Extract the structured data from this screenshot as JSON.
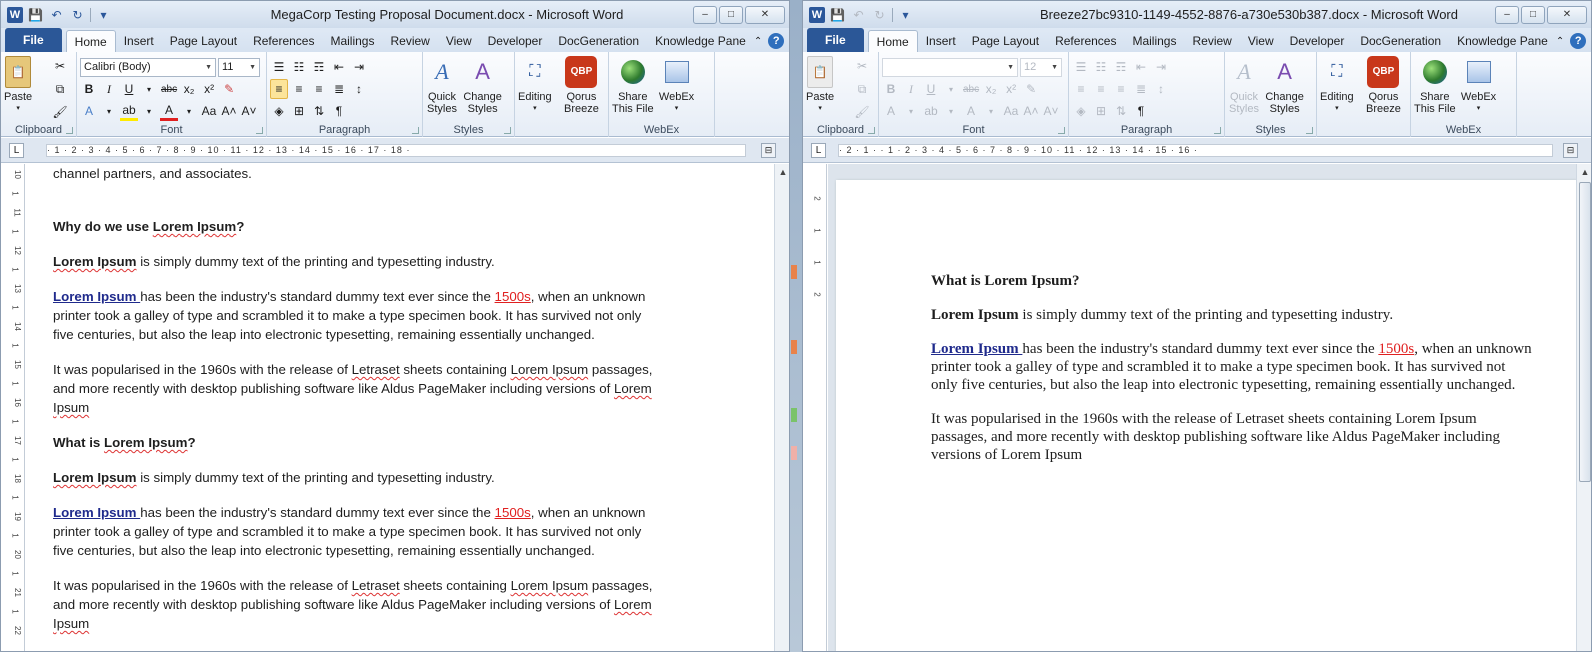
{
  "left": {
    "title": "MegaCorp Testing Proposal Document.docx  -  Microsoft Word",
    "tabs": [
      "File",
      "Home",
      "Insert",
      "Page Layout",
      "References",
      "Mailings",
      "Review",
      "View",
      "Developer",
      "DocGeneration",
      "Knowledge Pane"
    ],
    "font_name": "Calibri (Body)",
    "font_size": "11",
    "ruler": "· 1 · 2 · 3 · 4 · 5 · 6 · 7 · 8 · 9 · 10 · 11 · 12 · 13 · 14 · 15 · 16 · 17 · 18 ·",
    "vruler": [
      "10",
      "1",
      "11",
      "1",
      "12",
      "1",
      "13",
      "1",
      "14",
      "1",
      "15",
      "1",
      "16",
      "1",
      "17",
      "1",
      "18",
      "1",
      "19",
      "1",
      "20",
      "1",
      "21",
      "1",
      "22"
    ],
    "doc": {
      "p0": "channel partners, and associates.",
      "h1_a": "Why do we use ",
      "h1_b": "Lorem Ipsum",
      "h1_c": "?",
      "s1_a": "Lorem Ipsum",
      "s1_b": " is simply dummy text of the printing and typesetting industry.",
      "l1_a": "Lorem Ipsum ",
      "l1_b": "has been the industry's standard dummy text ever since the ",
      "l1_c": "1500s",
      "l1_d": ", when an unknown printer took a galley of type and scrambled it to make a type specimen book. It has survived not only five centuries, but also the leap into electronic typesetting, remaining essentially unchanged.",
      "p1_a": "It was popularised in the 1960s  with the release of ",
      "p1_b": "Letraset",
      "p1_c": " sheets containing ",
      "p1_d": "Lorem Ipsum",
      "p1_e": " passages, and more recently with desktop publishing software like Aldus PageMaker including versions of ",
      "p1_f": "Lorem Ipsum",
      "h2_a": "What is ",
      "h2_b": "Lorem Ipsum",
      "h2_c": "?",
      "s2_a": "Lorem Ipsum",
      "s2_b": " is simply dummy text of the printing and typesetting industry.",
      "l2_a": "Lorem Ipsum ",
      "l2_b": "has been the industry's standard dummy text ever since the ",
      "l2_c": "1500s",
      "l2_d": ", when an unknown printer took a galley of type and scrambled it to make a type specimen book. It has survived not only five centuries, but also the leap into electronic typesetting, remaining essentially unchanged.",
      "p2_a": "It was popularised in the 1960s  with the release of ",
      "p2_b": "Letraset",
      "p2_c": " sheets containing ",
      "p2_d": "Lorem Ipsum",
      "p2_e": " passages, and more recently with desktop publishing software like Aldus PageMaker including versions of ",
      "p2_f": "Lorem Ipsum"
    }
  },
  "right": {
    "title": "Breeze27bc9310-1149-4552-8876-a730e530b387.docx  -  Microsoft Word",
    "tabs": [
      "File",
      "Home",
      "Insert",
      "Page Layout",
      "References",
      "Mailings",
      "Review",
      "View",
      "Developer",
      "DocGeneration",
      "Knowledge Pane"
    ],
    "font_name": "",
    "font_size": "12",
    "ruler": "· 2 · 1 · · 1 · 2 · 3 · 4 · 5 · 6 · 7 · 8 · 9 · 10 · 11 · 12 · 13 · 14 · 15 · 16 ·",
    "vruler": [
      "2",
      "1",
      "1",
      "2"
    ],
    "doc": {
      "h_a": "What is Lorem Ipsum?",
      "s_a": "Lorem Ipsum",
      "s_b": " is simply dummy text of the printing and typesetting industry.",
      "l_a": "Lorem Ipsum ",
      "l_b": "has been the industry's standard dummy text ever since the ",
      "l_c": "1500s",
      "l_d": ", when an unknown printer took a galley of type and scrambled it to make a type specimen book. It has survived not only five centuries, but also the leap into electronic typesetting, remaining essentially unchanged.",
      "p": "It was popularised in the 1960s with the release of Letraset sheets containing Lorem Ipsum passages, and more recently with desktop publishing software like Aldus PageMaker including versions of Lorem Ipsum"
    }
  },
  "ribbon": {
    "clipboard": "Clipboard",
    "font": "Font",
    "paragraph": "Paragraph",
    "styles": "Styles",
    "webex": "WebEx",
    "paste": "Paste",
    "quick_styles_1": "Quick",
    "quick_styles_2": "Styles",
    "change_styles_1": "Change",
    "change_styles_2": "Styles",
    "editing": "Editing",
    "qorus_1": "Qorus",
    "qorus_2": "Breeze",
    "qbp": "QBP",
    "share_1": "Share",
    "share_2": "This File",
    "webex_btn": "WebEx"
  },
  "icons": {
    "word": "W",
    "help": "?",
    "minimize": "–",
    "maximize": "□",
    "close": "✕"
  },
  "colors": {
    "file_tab": "#2b5797",
    "link": "#1f2a8c",
    "red_link": "#e02020",
    "qorus": "#c8371a"
  }
}
